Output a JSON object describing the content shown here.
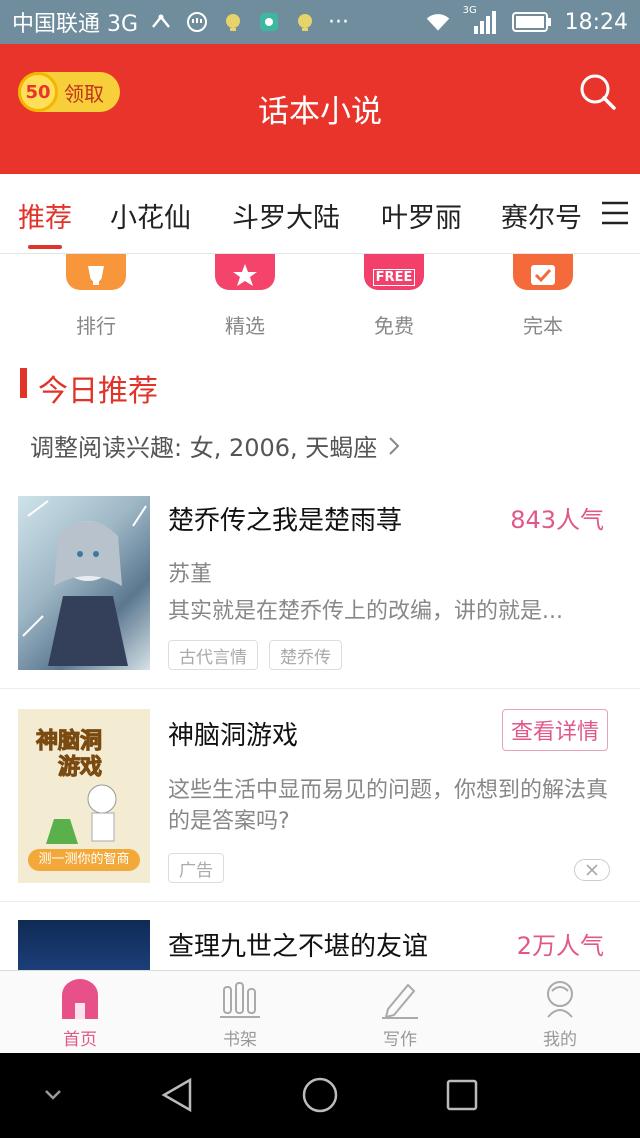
{
  "status_bar": {
    "carrier": "中国联通 3G",
    "network_badge": "3G",
    "time": "18:24",
    "icons": [
      "usb-icon",
      "shield-icon",
      "notification-icon",
      "wifi-icon",
      "signal-icon",
      "battery-icon"
    ],
    "more": "···"
  },
  "header": {
    "coin_value": "50",
    "coin_label": "领取",
    "title": "话本小说",
    "search_icon": "search-icon",
    "color": "#e8342b"
  },
  "tabs": [
    {
      "label": "推荐",
      "active": true
    },
    {
      "label": "小花仙",
      "active": false
    },
    {
      "label": "斗罗大陆",
      "active": false
    },
    {
      "label": "叶罗丽",
      "active": false
    },
    {
      "label": "赛尔号",
      "active": false
    }
  ],
  "categories": [
    {
      "label": "排行",
      "icon": "trophy-icon",
      "color": "#f7963a"
    },
    {
      "label": "精选",
      "icon": "star-icon",
      "color": "#f4446c"
    },
    {
      "label": "免费",
      "icon": "free-icon",
      "icon_text": "FREE",
      "color": "#f2406a"
    },
    {
      "label": "完本",
      "icon": "check-icon",
      "color": "#f46a3a"
    }
  ],
  "section": {
    "title": "今日推荐",
    "interest_text": "调整阅读兴趣: 女, 2006, 天蝎座"
  },
  "books": [
    {
      "title": "楚乔传之我是楚雨荨",
      "popularity": "843人气",
      "author": "苏堇",
      "description": "其实就是在楚乔传上的改编，讲的就是...",
      "tags": [
        "古代言情",
        "楚乔传"
      ]
    }
  ],
  "ad": {
    "title": "神脑洞游戏",
    "button": "查看详情",
    "description": "这些生活中显而易见的问题，你想到的解法真的是答案吗?",
    "tag": "广告",
    "cover_text_1": "神脑洞",
    "cover_text_2": "游戏",
    "cover_bottom": "测一测你的智商"
  },
  "book3": {
    "title": "查理九世之不堪的友谊",
    "popularity": "2万人气"
  },
  "bottom_nav": [
    {
      "label": "首页",
      "icon": "home-icon",
      "active": true
    },
    {
      "label": "书架",
      "icon": "bookshelf-icon",
      "active": false
    },
    {
      "label": "写作",
      "icon": "pen-icon",
      "active": false
    },
    {
      "label": "我的",
      "icon": "profile-icon",
      "active": false
    }
  ],
  "colors": {
    "accent": "#e0342a",
    "popularity": "#e0588a",
    "status_bar": "#6f8d9c"
  }
}
